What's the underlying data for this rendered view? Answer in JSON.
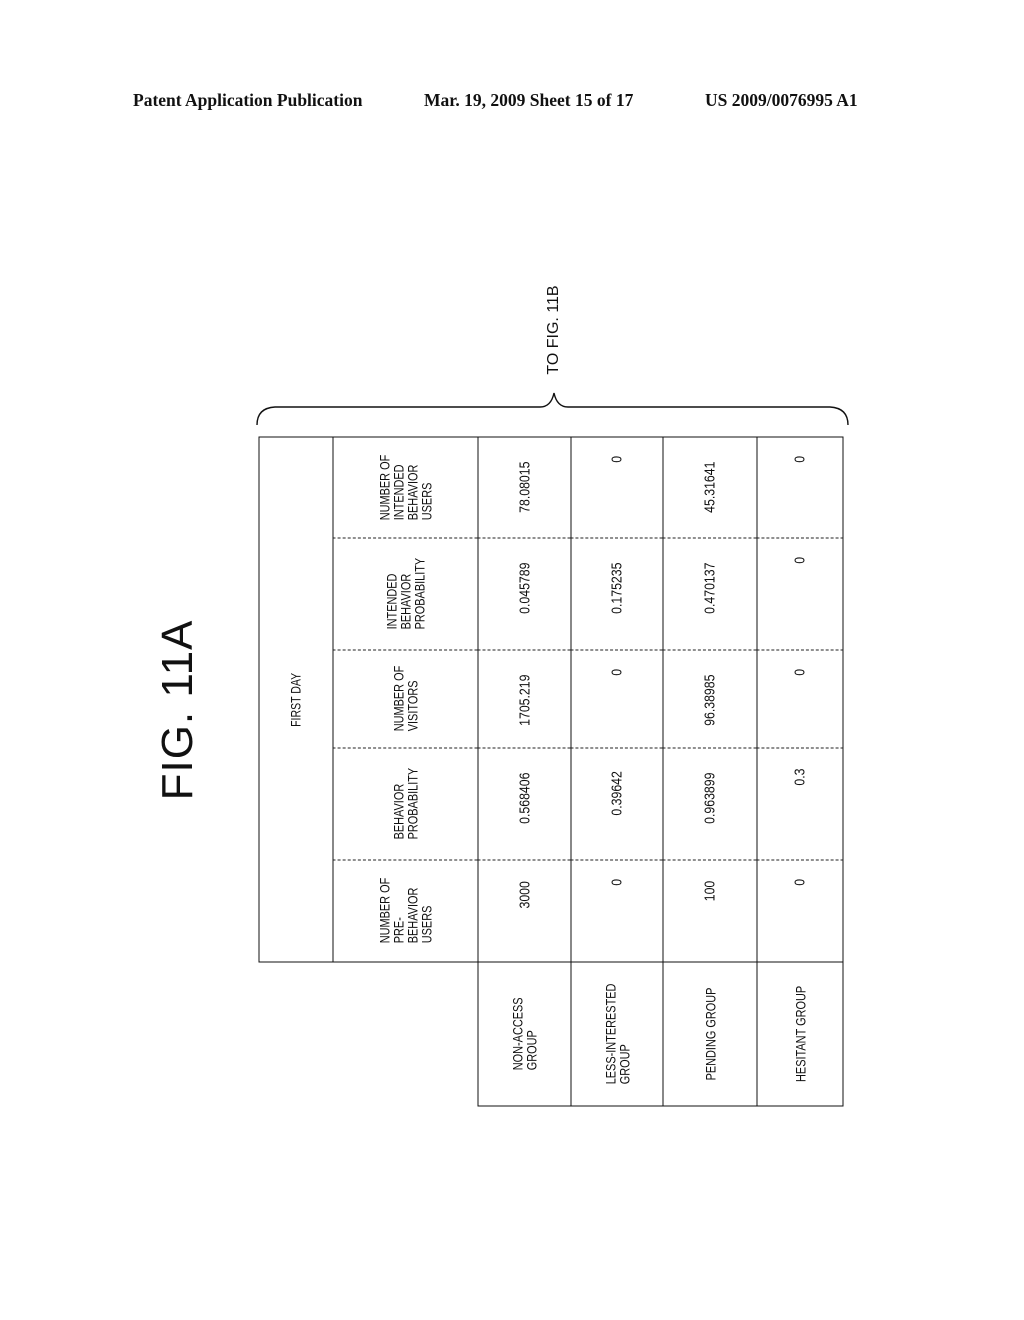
{
  "page_header": {
    "left": "Patent Application Publication",
    "middle": "Mar. 19, 2009  Sheet 15 of 17",
    "right": "US 2009/0076995 A1"
  },
  "figure": {
    "title": "FIG. 11A",
    "continuation_note": "TO FIG. 11B"
  },
  "table": {
    "period_header": "FIRST DAY",
    "columns": [
      "NUMBER OF PRE-BEHAVIOR USERS",
      "BEHAVIOR PROBABILITY",
      "NUMBER OF VISITORS",
      "INTENDED BEHAVIOR PROBABILITY",
      "NUMBER OF INTENDED BEHAVIOR USERS"
    ],
    "column_lines": [
      [
        "NUMBER OF",
        "PRE-",
        "BEHAVIOR",
        "USERS"
      ],
      [
        "BEHAVIOR",
        "PROBABILITY"
      ],
      [
        "NUMBER OF",
        "VISITORS"
      ],
      [
        "INTENDED",
        "BEHAVIOR",
        "PROBABILITY"
      ],
      [
        "NUMBER OF",
        "INTENDED",
        "BEHAVIOR",
        "USERS"
      ]
    ],
    "rows": [
      {
        "group": "NON-ACCESS GROUP",
        "group_lines": [
          "NON-ACCESS",
          "GROUP"
        ],
        "values": [
          "3000",
          "0.568406",
          "1705.219",
          "0.045789",
          "78.08015"
        ]
      },
      {
        "group": "LESS-INTERESTED GROUP",
        "group_lines": [
          "LESS-INTERESTED",
          "GROUP"
        ],
        "values": [
          "0",
          "0.39642",
          "0",
          "0.175235",
          "0"
        ]
      },
      {
        "group": "PENDING GROUP",
        "group_lines": [
          "PENDING GROUP"
        ],
        "values": [
          "100",
          "0.963899",
          "96.38985",
          "0.470137",
          "45.31641"
        ]
      },
      {
        "group": "HESITANT GROUP",
        "group_lines": [
          "HESITANT GROUP"
        ],
        "values": [
          "0",
          "0.3",
          "0",
          "0",
          "0"
        ]
      }
    ]
  }
}
